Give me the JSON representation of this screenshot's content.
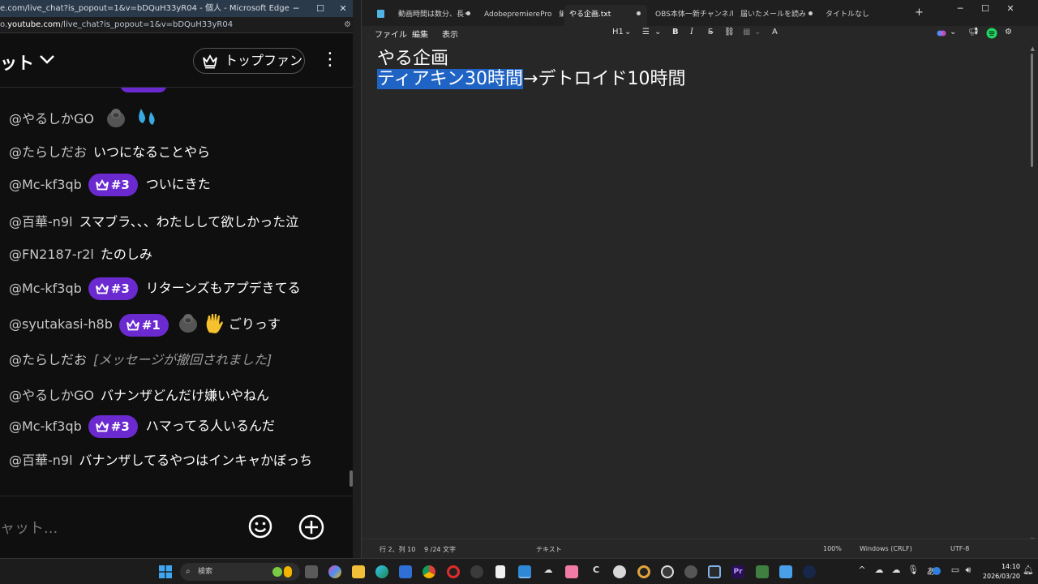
{
  "edge": {
    "title": "e.com/live_chat?is_popout=1&v=bDQuH33yR04 - 個人 - Microsoft Edge",
    "url_prefix": "o.",
    "url_host": "youtube.com",
    "url_path": "/live_chat?is_popout=1&v=bDQuH33yR04",
    "minimize": "─",
    "maximize": "☐",
    "close": "✕"
  },
  "chat": {
    "header_title": "ット",
    "header_caret": "⌄",
    "top_fan_label": "トップファン",
    "kebab": "⋮",
    "messages": [
      {
        "author": "@やるしかGO",
        "text": ""
      },
      {
        "author": "@たらしだお",
        "text": "いつになることやら"
      },
      {
        "author": "@Mc-kf3qb",
        "badge": "#3",
        "text": "ついにきた"
      },
      {
        "author": "@百華-n9l",
        "text": "スマブラ、、、わたしして欲しかった泣"
      },
      {
        "author": "@FN2187-r2l",
        "text": "たのしみ"
      },
      {
        "author": "@Mc-kf3qb",
        "badge": "#3",
        "text": "リターンズもアプデきてる"
      },
      {
        "author": "@syutakasi-h8b",
        "badge": "#1",
        "text": "ごりっす"
      },
      {
        "author": "@たらしだお",
        "retracted": "[メッセージが撤回されました]"
      },
      {
        "author": "@やるしかGO",
        "text": "バナンザどんだけ嫌いやねん"
      },
      {
        "author": "@Mc-kf3qb",
        "badge": "#3",
        "text": "ハマってる人いるんだ"
      },
      {
        "author": "@百華-n9l",
        "text": "バナンザしてるやつはインキャかぼっち"
      }
    ],
    "input_placeholder": "ャット..."
  },
  "notepad": {
    "tabs": [
      {
        "label": "動画時間は数分、長ぐ"
      },
      {
        "label": "AdobepremierePro　編集方"
      },
      {
        "label": "やる企画.txt"
      },
      {
        "label": "OBS本体一新チャンネル＆Tik"
      },
      {
        "label": "届いたメールを読みます"
      },
      {
        "label": "タイトルなし"
      }
    ],
    "new_tab": "+",
    "minimize": "─",
    "maximize": "☐",
    "close": "✕",
    "menu": {
      "file": "ファイル",
      "edit": "編集",
      "view": "表示"
    },
    "toolbar": {
      "heading": "H1",
      "heading_caret": "⌄",
      "list": "☰",
      "list_caret": "⌄",
      "bold": "B",
      "italic": "I",
      "strike": "S",
      "link": "⛓",
      "table": "▦",
      "table_caret": "⌄",
      "clear": "A"
    },
    "line1": "やる企画",
    "line2_selected": "ティアキン30時間",
    "line2_rest": "→デトロイド10時間",
    "status": {
      "position": "行 2、列 10",
      "chars": "9 /24 文字",
      "format": "テキスト",
      "zoom": "100%",
      "line_ending": "Windows (CRLF)",
      "encoding": "UTF-8"
    }
  },
  "taskbar": {
    "search_label": "検索",
    "search_icon": "⌕",
    "tray_caret": "^",
    "ime": "あ",
    "time": "14:10",
    "date": "2026/03/20"
  }
}
